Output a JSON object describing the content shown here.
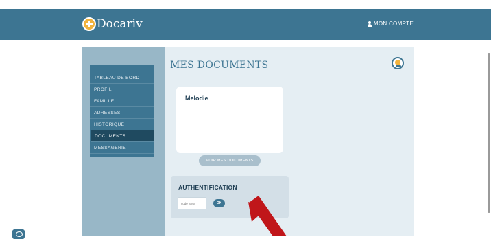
{
  "header": {
    "logo_text": "Docariv",
    "account_label": "MON COMPTE"
  },
  "sidebar": {
    "items": [
      {
        "label": "TABLEAU DE BORD"
      },
      {
        "label": "PROFIL"
      },
      {
        "label": "FAMILLE"
      },
      {
        "label": "ADRESSES"
      },
      {
        "label": "HISTORIQUE"
      },
      {
        "label": "DOCUMENTS",
        "active": true
      },
      {
        "label": "MESSAGERIE"
      }
    ]
  },
  "main": {
    "title": "MES DOCUMENTS",
    "document_card": {
      "name": "Melodie"
    },
    "view_button_label": "VOIR MES DOCUMENTS",
    "auth": {
      "title": "AUTHENTIFICATION",
      "code_placeholder": "code SMS",
      "ok_label": "OK"
    }
  },
  "colors": {
    "brand": "#3d7592",
    "sidebar_bg": "#98b7c7",
    "content_bg": "#e5eef3",
    "accent": "#f2b33d",
    "arrow": "#c0161a"
  },
  "icons": {
    "logo": "docariv-logo-icon",
    "account": "user-icon",
    "help": "assistant-icon",
    "chat": "chat-icon"
  }
}
